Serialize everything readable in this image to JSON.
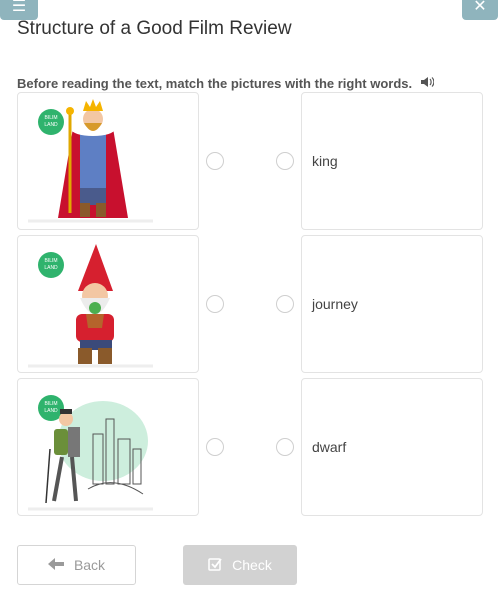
{
  "header": {
    "title": "Structure of a Good Film Review",
    "instruction": "Before reading the text, match the pictures with the right words."
  },
  "exercise": {
    "pictures": [
      {
        "icon": "king-picture",
        "badge": "BILIM LAND"
      },
      {
        "icon": "gnome-picture",
        "badge": "BILIM LAND"
      },
      {
        "icon": "hiker-picture",
        "badge": "BILIM LAND"
      }
    ],
    "words": [
      "king",
      "journey",
      "dwarf"
    ]
  },
  "footer": {
    "back_label": "Back",
    "check_label": "Check"
  }
}
